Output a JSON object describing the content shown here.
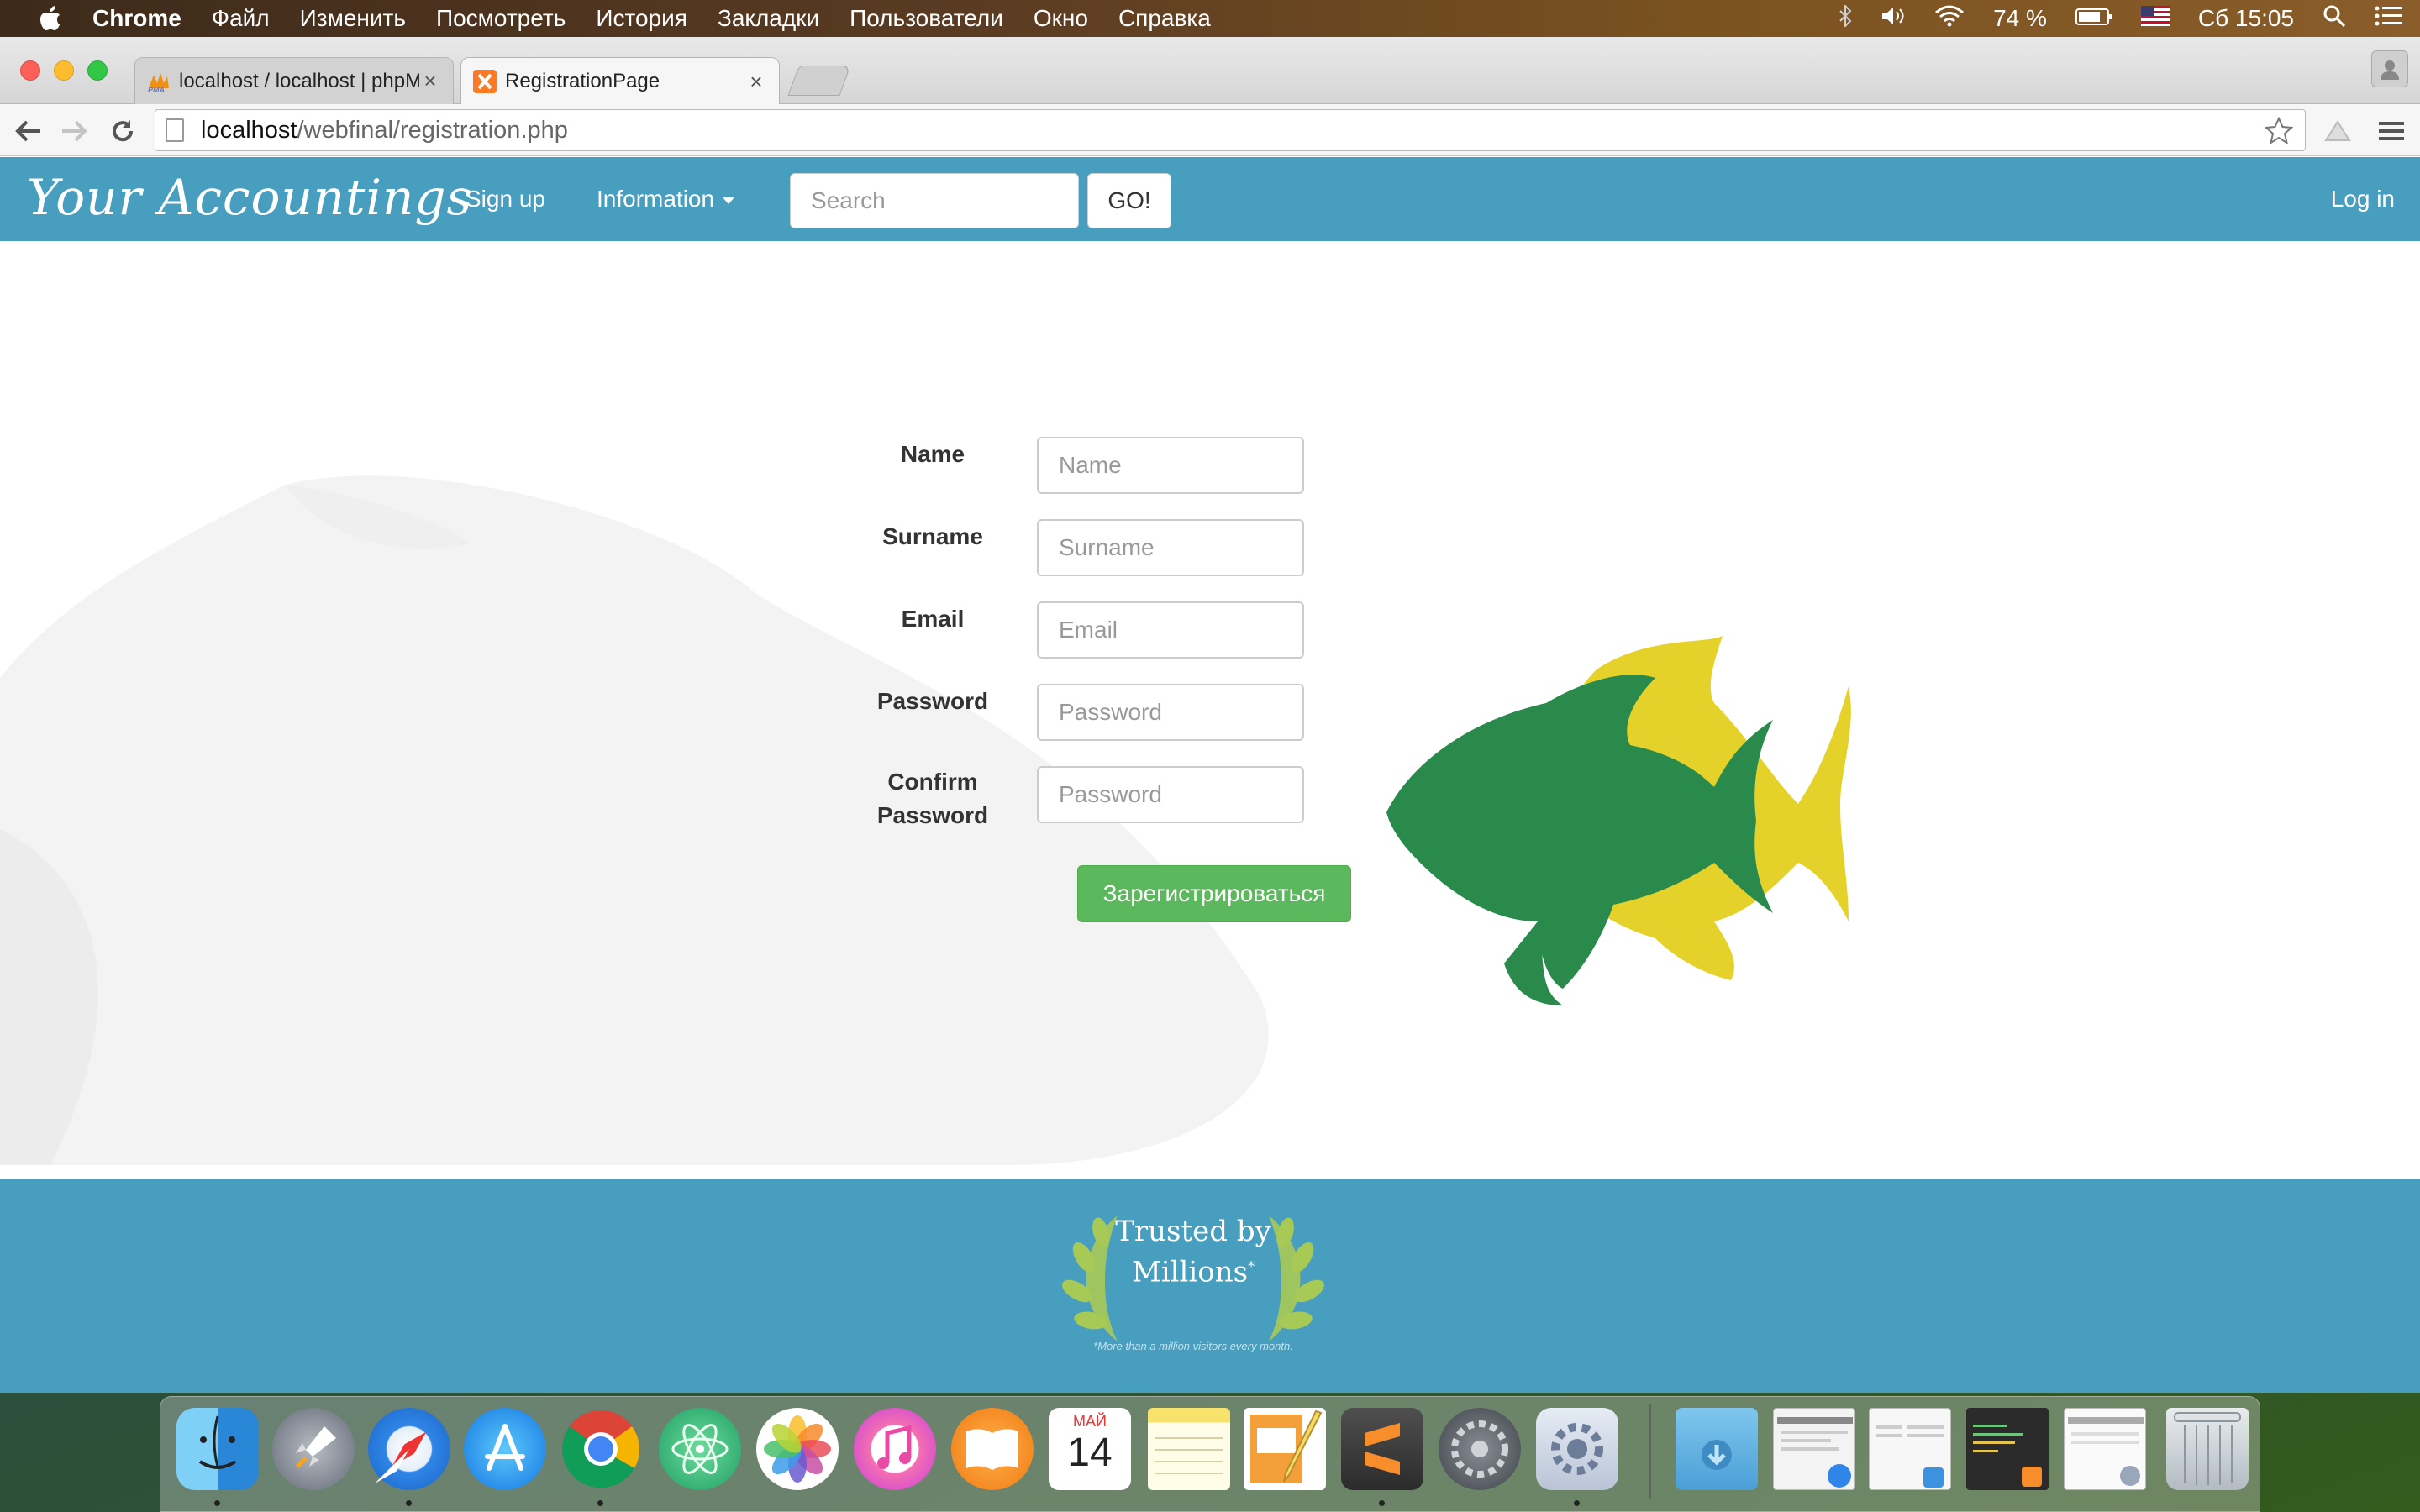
{
  "menubar": {
    "app_name": "Chrome",
    "items": [
      "Файл",
      "Изменить",
      "Посмотреть",
      "История",
      "Закладки",
      "Пользователи",
      "Окно",
      "Справка"
    ],
    "battery": "74 %",
    "clock": "Сб 15:05"
  },
  "browser": {
    "tabs": [
      {
        "title": "localhost / localhost | phpM",
        "favicon": "phpmyadmin-icon",
        "active": false
      },
      {
        "title": "RegistrationPage",
        "favicon": "xampp-icon",
        "active": true
      }
    ],
    "url_host": "localhost",
    "url_path": "/webfinal/registration.php"
  },
  "site": {
    "brand": "Your Accountings",
    "nav": {
      "signup": "Sign up",
      "information": "Information",
      "login": "Log in"
    },
    "search": {
      "placeholder": "Search",
      "button": "GO!"
    },
    "accent_color": "#489ebf"
  },
  "form": {
    "fields": [
      {
        "label": "Name",
        "placeholder": "Name"
      },
      {
        "label": "Surname",
        "placeholder": "Surname"
      },
      {
        "label": "Email",
        "placeholder": "Email"
      },
      {
        "label": "Password",
        "placeholder": "Password"
      },
      {
        "label_line1": "Confirm",
        "label_line2": "Password",
        "placeholder": "Password"
      }
    ],
    "submit": "Зарегистрироваться",
    "submit_color": "#5cb85c"
  },
  "footer": {
    "badge_line1": "Trusted by",
    "badge_line2": "Millions",
    "badge_mark": "*",
    "fineprint": "*More than a million visitors every month."
  },
  "dock": {
    "apps": [
      "finder-icon",
      "launchpad-icon",
      "safari-icon",
      "app-store-icon",
      "chrome-icon",
      "atom-icon",
      "photos-icon",
      "itunes-icon",
      "ibooks-icon",
      "calendar-icon",
      "notes-icon",
      "pages-icon",
      "sublime-text-icon",
      "system-preferences-icon",
      "utility-gear-icon"
    ],
    "calendar": {
      "month": "МАЙ",
      "day": "14"
    },
    "right_items": [
      "downloads-folder-icon",
      "minimized-safari-window",
      "minimized-finder-window",
      "minimized-sublime-window",
      "minimized-window",
      "trash-icon"
    ]
  }
}
